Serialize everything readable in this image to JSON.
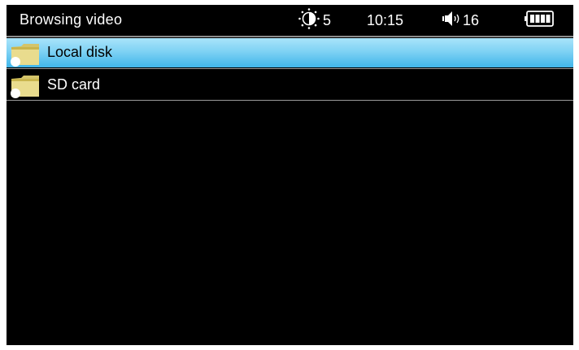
{
  "header": {
    "title": "Browsing video",
    "brightness_value": "5",
    "time": "10:15",
    "volume_value": "16"
  },
  "icons": {
    "brightness": "brightness-icon",
    "volume": "speaker-icon",
    "battery": "battery-icon",
    "folder": "folder-icon"
  },
  "list": {
    "items": [
      {
        "label": "Local disk",
        "selected": true
      },
      {
        "label": "SD card",
        "selected": false
      }
    ]
  },
  "colors": {
    "background": "#000000",
    "selection": "#6fcdf3",
    "text": "#ffffff",
    "selected_text": "#000000"
  }
}
